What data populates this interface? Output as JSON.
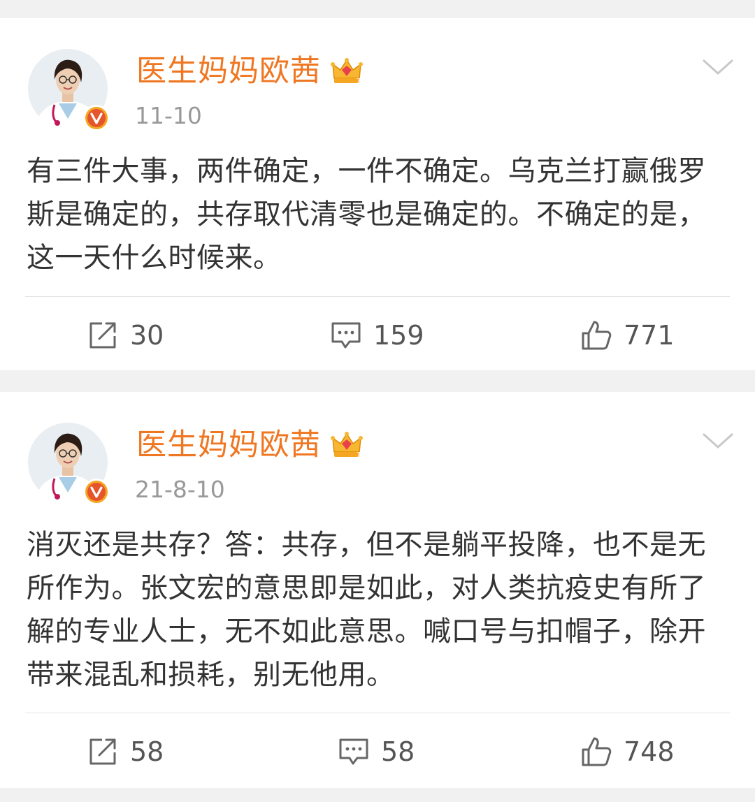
{
  "posts": [
    {
      "username": "医生妈妈欧茜",
      "date": "11-10",
      "content": "有三件大事，两件确定，一件不确定。乌克兰打赢俄罗斯是确定的，共存取代清零也是确定的。不确定的是，这一天什么时候来。",
      "reposts": "30",
      "comments": "159",
      "likes": "771"
    },
    {
      "username": "医生妈妈欧茜",
      "date": "21-8-10",
      "content": "消灭还是共存？答：共存，但不是躺平投降，也不是无所作为。张文宏的意思即是如此，对人类抗疫史有所了解的专业人士，无不如此意思。喊口号与扣帽子，除开带来混乱和损耗，别无他用。",
      "reposts": "58",
      "comments": "58",
      "likes": "748"
    }
  ],
  "icons": {
    "verified_badge": "verified-v-icon",
    "crown": "crown-icon",
    "menu": "chevron-down-icon",
    "repost": "repost-icon",
    "comment": "comment-icon",
    "like": "like-icon"
  },
  "colors": {
    "username": "#f07722",
    "text": "#333333",
    "meta": "#999999",
    "background": "#f1f1f1",
    "card": "#ffffff",
    "badge": "#f5a623"
  }
}
